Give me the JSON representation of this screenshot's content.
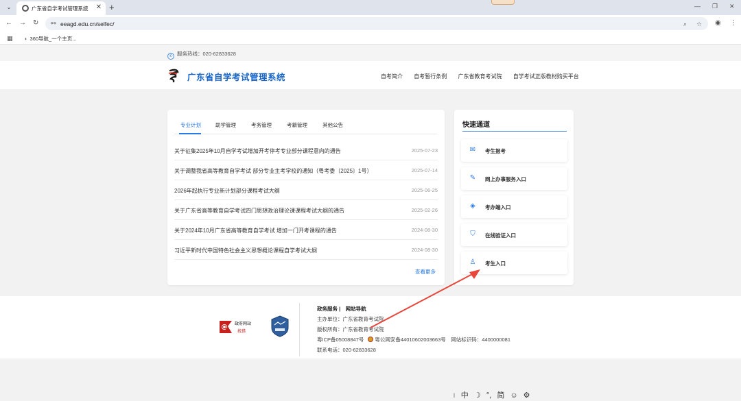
{
  "browser": {
    "tab_title": "广东省自学考试管理系统",
    "url": "eeagd.edu.cn/selfec/",
    "bookmark": "360导航_一个主页...",
    "icons": [
      "chevron-down-icon",
      "favicon-icon",
      "close-icon",
      "plus-icon",
      "back-icon",
      "forward-icon",
      "reload-icon",
      "site-settings-icon",
      "zoom-icon",
      "star-icon",
      "profile-icon",
      "menu-icon",
      "apps-icon",
      "minimize-icon",
      "restore-icon",
      "close-window-icon"
    ]
  },
  "site": {
    "hotline": "服务热线：020-62833628",
    "title": "广东省自学考试管理系统",
    "nav": [
      "自考简介",
      "自考暂行条例",
      "广东省教育考试院",
      "自学考试正版教材购买平台"
    ]
  },
  "news": {
    "tabs": [
      "专业计划",
      "助学管理",
      "考务管理",
      "考籍管理",
      "其他公告"
    ],
    "active_tab": 0,
    "items": [
      {
        "title": "关于征集2025年10月自学考试增加开考停考专业部分课程意向的通告",
        "date": "2025-07-23"
      },
      {
        "title": "关于调整我省高等教育自学考试 部分专业主考学校的通知（粤考委〔2025〕1号）",
        "date": "2025-07-14"
      },
      {
        "title": "2026年起执行专业新计划部分课程考试大纲",
        "date": "2025-06-25"
      },
      {
        "title": "关于广东省高等教育自学考试四门思想政治理论课课程考试大纲的通告",
        "date": "2025-02-26"
      },
      {
        "title": "关于2024年10月广东省高等教育自学考试 增加一门开考课程的通告",
        "date": "2024-08-30"
      },
      {
        "title": "习近平新时代中国特色社会主义思想概论课程自学考试大纲",
        "date": "2024-08-30"
      }
    ],
    "more": "查看更多"
  },
  "quick": {
    "title": "快速通道",
    "items": [
      {
        "label": "考生报考",
        "icon": "mail-icon"
      },
      {
        "label": "网上办事服务入口",
        "icon": "document-edit-icon"
      },
      {
        "label": "考办端入口",
        "icon": "graduation-cap-icon"
      },
      {
        "label": "在线验证入口",
        "icon": "shield-icon"
      },
      {
        "label": "考生入口",
        "icon": "user-icon"
      }
    ]
  },
  "footer": {
    "links": "政务服务 |　网站导航",
    "host": "主办单位：广东省教育考试院",
    "copyright": "版权所有：广东省教育考试院",
    "icp": "粤ICP备05008847号",
    "police": "粤公网安备44010602003663号",
    "site_code": "网站标识码：4400000081",
    "phone": "联系电话：020-62833628",
    "gov_logo_top": "政府网站",
    "gov_logo_bottom": "找错"
  },
  "ime": [
    "‖",
    "中",
    "☽",
    "°,",
    "简",
    "☺",
    "⚙"
  ],
  "colors": {
    "accent": "#2a7ae2",
    "title_blue": "#1664c6",
    "arrow": "#e8463a"
  }
}
